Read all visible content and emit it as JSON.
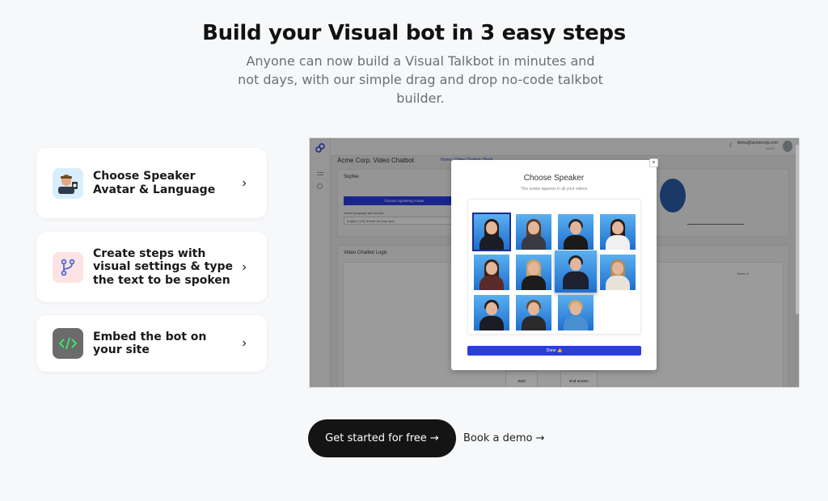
{
  "hero": {
    "title": "Build your Visual bot in 3 easy steps",
    "subtitle": "Anyone can now build a Visual Talkbot in minutes and not days, with our simple drag and drop no-code talkbot builder."
  },
  "steps": [
    {
      "label": "Choose Speaker Avatar & Language",
      "icon": "speaker-avatar-icon",
      "icon_bg": "#d8eefc"
    },
    {
      "label": "Create steps with visual settings & type the text to be spoken",
      "icon": "branch-icon",
      "icon_bg": "#fde3e3"
    },
    {
      "label": "Embed the bot on your site",
      "icon": "code-icon",
      "icon_bg": "#6b6b6b"
    }
  ],
  "chevron": "›",
  "preview": {
    "app_title": "Acme Corp. Video Chatbot",
    "breadcrumb": "Home / Video Chatbot / Build",
    "user_email": "demo@acmecorp.com",
    "user_role": "admin",
    "speaker_name": "Sophie",
    "speaker_button": "Choose Speaking Avatar",
    "language_label": "Select language and accent",
    "language_value": "English (US) female (human-like)",
    "logic_title": "Video Chatbot Logic",
    "zoom_label": "Zoom: 1",
    "start_label": "Start",
    "end_label": "End Screen",
    "modal": {
      "title": "Choose Speaker",
      "subtitle": "This avatar appears in all your videos",
      "close": "×",
      "done": "Done 👍"
    }
  },
  "cta": {
    "primary": "Get started for free →",
    "secondary": "Book a demo →"
  },
  "colors": {
    "accent": "#2b3de0",
    "cta_bg": "#141414",
    "page_bg": "#f7f8fa"
  }
}
